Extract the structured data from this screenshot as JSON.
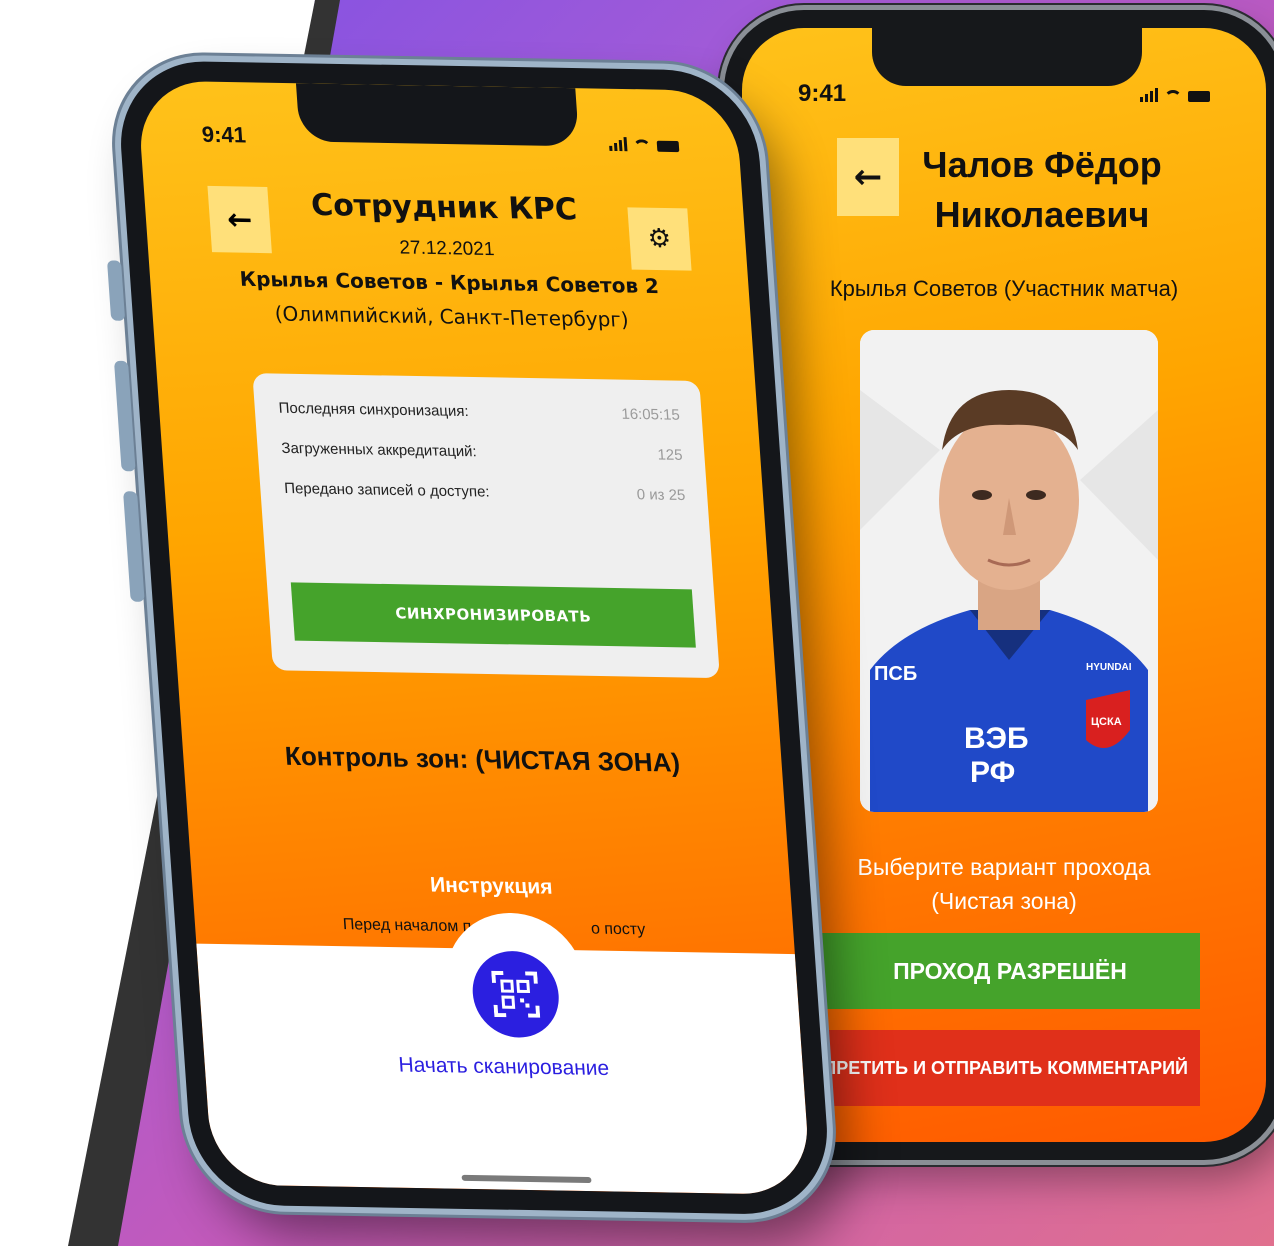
{
  "left_phone": {
    "status_time": "9:41",
    "title": "Сотрудник КРС",
    "date": "27.12.2021",
    "match": "Крылья Советов - Крылья Советов 2",
    "venue": "(Олимпийский, Санкт-Петербург)",
    "sync": {
      "rows": [
        {
          "label": "Последняя синхронизация:",
          "value": "16:05:15"
        },
        {
          "label": "Загруженных аккредитаций:",
          "value": "125"
        },
        {
          "label": "Передано записей о доступе:",
          "value": "0 из 25"
        }
      ],
      "button": "СИНХРОНИЗИРОВАТЬ"
    },
    "zone_control": "Контроль зон: (ЧИСТАЯ ЗОНА)",
    "instruction_title": "Инструкция",
    "instruction_text": "Перед началом п",
    "instruction_text_end": "о посту",
    "scan_label": "Начать сканирование"
  },
  "right_phone": {
    "status_time": "9:41",
    "name_line1": "Чалов Фёдор",
    "name_line2": "Николаевич",
    "team": "Крылья Советов (Участник матча)",
    "photo_sponsor": "ПСБ",
    "photo_sponsor2": "HYUNDAI",
    "photo_sponsor3_line1": "ВЭБ",
    "photo_sponsor3_line2": "РФ",
    "photo_club": "ЦСКА",
    "select_line1": "Выберите вариант прохода",
    "select_line2": "(Чистая зона)",
    "allow_button": "ПРОХОД РАЗРЕШЁН",
    "deny_button": "ПРЕТИТЬ И ОТПРАВИТЬ КОММЕНТАРИЙ"
  },
  "colors": {
    "orange_top": "#ffc21a",
    "orange_bottom": "#ff5a00",
    "green": "#45a32b",
    "red": "#e0301a",
    "scan_blue": "#2b1fe0"
  },
  "icons": [
    "back-arrow-icon",
    "gear-icon",
    "qr-scan-icon",
    "signal-icon",
    "wifi-icon",
    "battery-icon"
  ]
}
